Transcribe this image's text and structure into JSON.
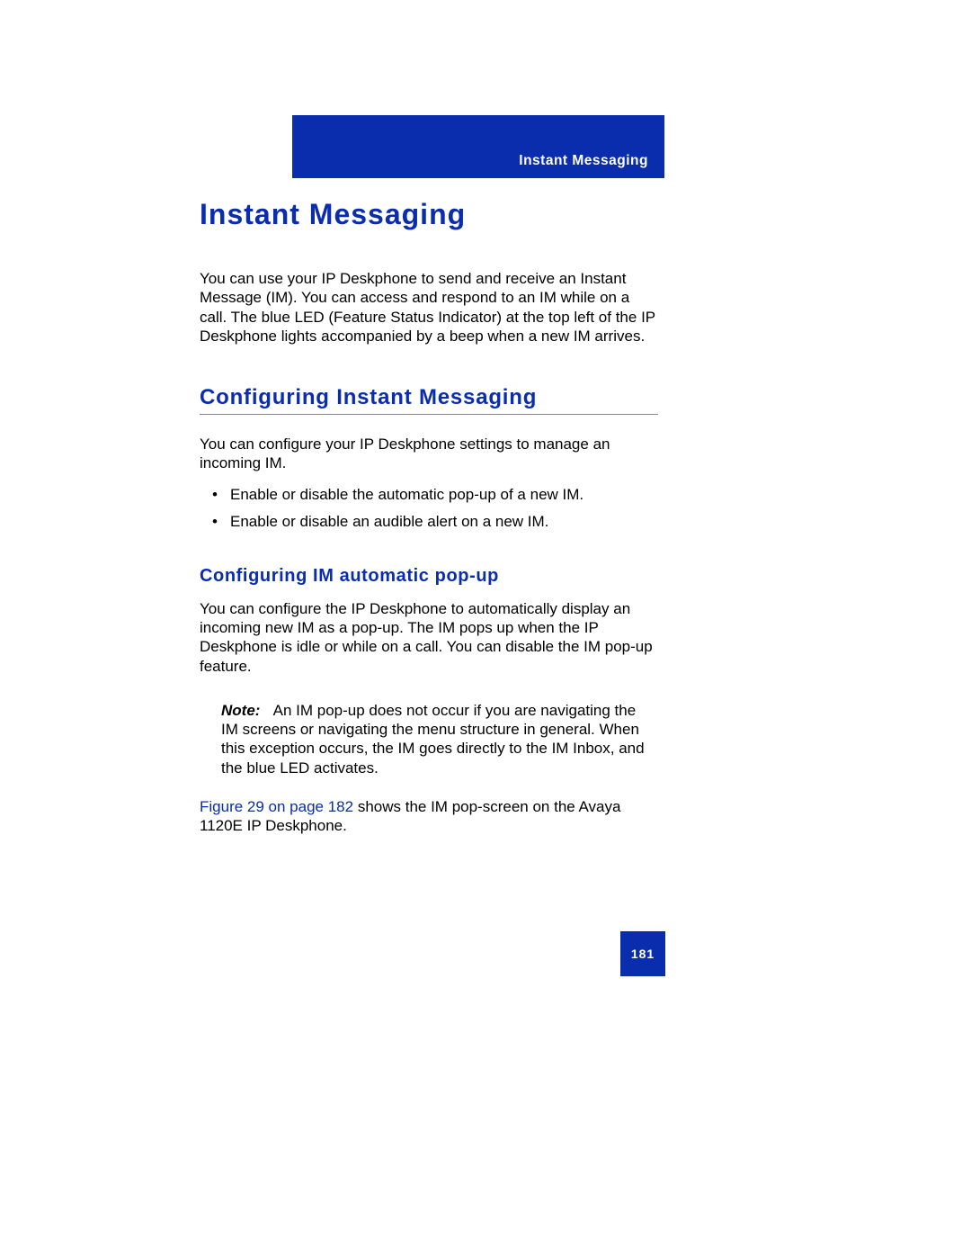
{
  "header": {
    "section_label": "Instant Messaging"
  },
  "h1": "Instant Messaging",
  "intro_para": "You can use your IP Deskphone to send and receive an Instant Message (IM). You can access and respond to an IM while on a call. The blue LED (Feature Status Indicator) at the top left of the IP Deskphone lights accompanied by a beep when a new IM arrives.",
  "section1": {
    "heading": "Configuring Instant Messaging",
    "para": "You can configure your IP Deskphone settings to manage an incoming IM.",
    "bullets": [
      "Enable or disable the automatic pop-up of a new IM.",
      "Enable or disable an audible alert on a new IM."
    ]
  },
  "section2": {
    "heading": "Configuring IM automatic pop-up",
    "para": "You can configure the IP Deskphone to automatically display an incoming new IM as a pop-up. The IM pops up when the IP Deskphone is idle or while on a call. You can disable the IM pop-up feature.",
    "note_label": "Note:",
    "note_body": "An IM pop-up does not occur if you are navigating the IM screens or navigating the menu structure in general. When this exception occurs, the IM goes directly to the IM Inbox, and the blue LED activates.",
    "ref_link": "Figure 29 on page 182",
    "ref_tail": " shows the IM pop-screen on the Avaya 1120E IP Deskphone."
  },
  "page_number": "181"
}
